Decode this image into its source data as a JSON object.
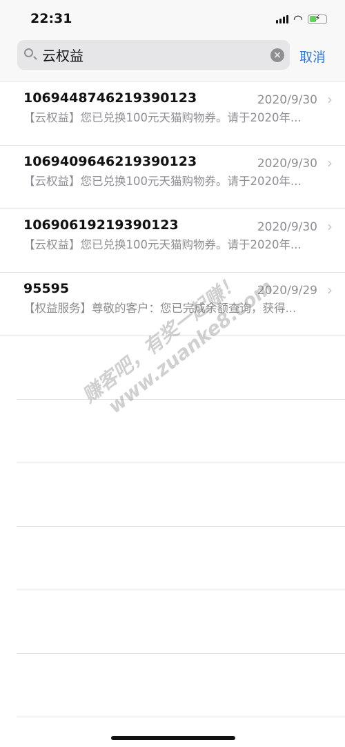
{
  "status_bar": {
    "time": "22:31",
    "battery_charging": true
  },
  "search": {
    "value": "云权益",
    "cancel_label": "取消"
  },
  "messages": [
    {
      "sender": "1069448746219390123",
      "date": "2020/9/30",
      "preview": "【云权益】您已兑换100元天猫购物券。请于2020年..."
    },
    {
      "sender": "1069409646219390123",
      "date": "2020/9/30",
      "preview": "【云权益】您已兑换100元天猫购物券。请于2020年..."
    },
    {
      "sender": "10690619219390123",
      "date": "2020/9/30",
      "preview": "【云权益】您已兑换100元天猫购物券。请于2020年..."
    },
    {
      "sender": "95595",
      "date": "2020/9/29",
      "preview": "【权益服务】尊敬的客户：您已完成余额查询，获得..."
    }
  ],
  "watermark": {
    "line1": "赚客吧，有奖一起赚！",
    "line2": "www.zuanke8.com"
  }
}
